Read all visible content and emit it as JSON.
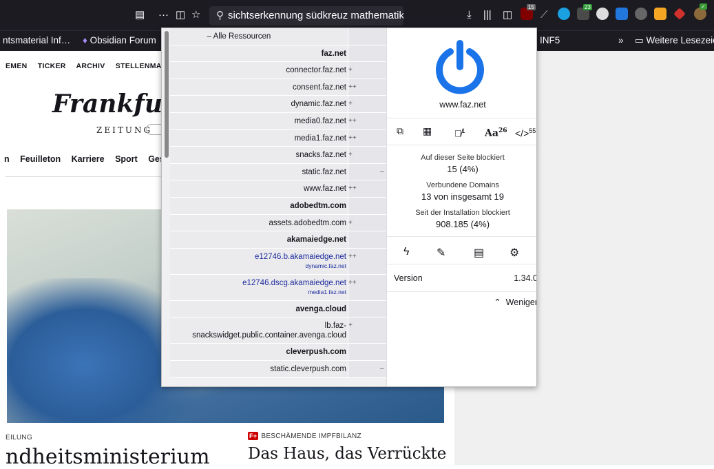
{
  "browser": {
    "url_text": "sichtserkennung südkreuz mathematik",
    "ublock_badge": "15",
    "ext_badge_1": "23",
    "bookmarks": {
      "item1": "ntsmaterial Inf…",
      "item2": "Obsidian Forum",
      "item3": "INF5",
      "more": "»",
      "folder": "Weitere Lesezeich"
    }
  },
  "page": {
    "top_nav": [
      "EMEN",
      "TICKER",
      "ARCHIV",
      "STELLENMARKT"
    ],
    "logo": "Frankfurter",
    "zeitung": "ZEITUNG",
    "main_nav": [
      "n",
      "Feuilleton",
      "Karriere",
      "Sport",
      "Ges"
    ],
    "kicker1": "EILUNG",
    "headline1": "ndheitsministerium",
    "kicker2_badge": "F+",
    "kicker2": "BESCHÄMENDE IMPFBILANZ",
    "headline2": "Das Haus, das Verrückte"
  },
  "ublock": {
    "all_resources": "– Alle Ressourcen",
    "rows": [
      {
        "name": "faz.net",
        "header": true
      },
      {
        "name": "connector.faz.net",
        "mark": "+",
        "bar": "green",
        "bar_w": 6
      },
      {
        "name": "consent.faz.net",
        "mark": "++",
        "bar": "green",
        "bar_w": 6
      },
      {
        "name": "dynamic.faz.net",
        "mark": "+",
        "bar": "green",
        "bar_w": 6
      },
      {
        "name": "media0.faz.net",
        "mark": "++",
        "bar": "green",
        "bar_w": 6
      },
      {
        "name": "media1.faz.net",
        "mark": "++",
        "bar": "green",
        "bar_w": 6
      },
      {
        "name": "snacks.faz.net",
        "mark": "+",
        "bar": "green",
        "bar_w": 6
      },
      {
        "name": "static.faz.net",
        "minus": "–",
        "bar": "red",
        "bar_w": 6
      },
      {
        "name": "www.faz.net",
        "mark": "++",
        "bar": "green",
        "bar_w": 12
      },
      {
        "name": "adobedtm.com",
        "header": true
      },
      {
        "name": "assets.adobedtm.com",
        "mark": "+",
        "bar": "green",
        "bar_w": 6
      },
      {
        "name": "akamaiedge.net",
        "header": true
      }
    ],
    "tall_rows": [
      {
        "name": "e12746.b.akamaiedge.net",
        "sub": "dynamic.faz.net",
        "mark": "++"
      },
      {
        "name": "e12746.dscg.akamaiedge.net",
        "sub": "media1.faz.net",
        "mark": "++"
      }
    ],
    "avenga_header": "avenga.cloud",
    "avenga_row_line1": "lb.faz-",
    "avenga_row_line2": "snackswidget.public.container.avenga.cloud",
    "avenga_mark": "+",
    "cleverpush_header": "cleverpush.com",
    "cleverpush_row": "static.cleverpush.com",
    "cleverpush_minus": "–",
    "hostname": "www.faz.net",
    "tool_counts": {
      "remote_fonts": "1",
      "fonts": "26",
      "scripts": "55"
    },
    "fonts_label": "Aa",
    "scripts_label": "</>",
    "blocked_label": "Auf dieser Seite blockiert",
    "blocked_value": "15 (4%)",
    "domains_label": "Verbundene Domains",
    "domains_value": "13 von insgesamt 19",
    "since_label": "Seit der Installation blockiert",
    "since_value": "908.185 (4%)",
    "version_label": "Version",
    "version_value": "1.34.0",
    "less_label": "Weniger",
    "power_color": "#1a73e8"
  }
}
